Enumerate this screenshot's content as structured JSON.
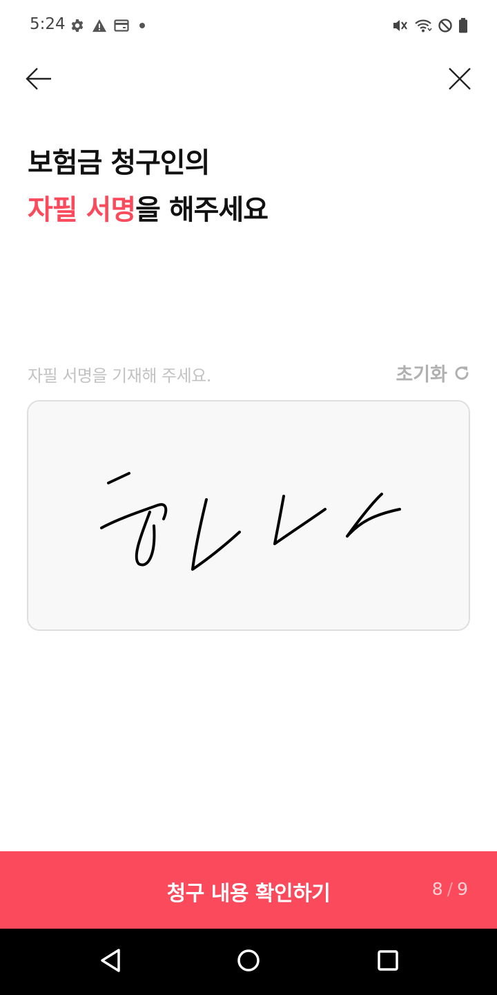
{
  "status_bar": {
    "time": "5:24",
    "left_icons": [
      "settings-icon",
      "alert-icon",
      "card-icon",
      "dot-icon"
    ],
    "right_icons": [
      "vibrate-icon",
      "wifi-icon",
      "dnd-icon",
      "battery-icon"
    ]
  },
  "nav": {
    "back_icon": "arrow-left-icon",
    "close_icon": "close-icon"
  },
  "title": {
    "line1": "보험금 청구인의",
    "line2_accent": "자필 서명",
    "line2_rest": "을 해주세요"
  },
  "signature": {
    "instruction": "자필 서명을 기재해 주세요.",
    "reset_label": "초기화",
    "reset_icon": "refresh-icon"
  },
  "cta": {
    "label": "청구 내용 확인하기",
    "step_current": "8",
    "step_separator": "/",
    "step_total": "9"
  },
  "colors": {
    "accent": "#fa4a5c",
    "pad_bg": "#f8f8f8",
    "hint": "#c2c2c2"
  }
}
